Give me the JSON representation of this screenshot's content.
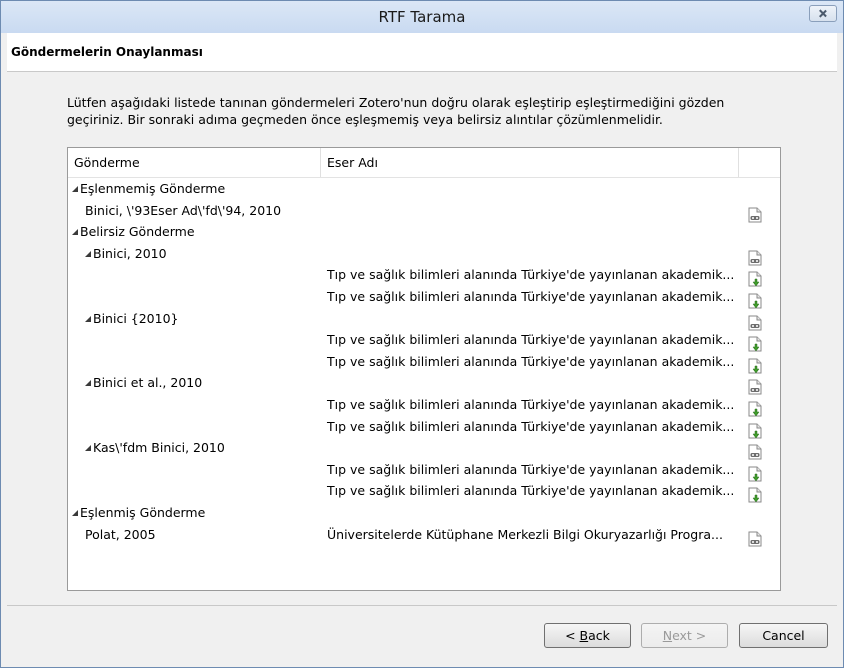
{
  "window": {
    "title": "RTF Tarama"
  },
  "page": {
    "title": "Göndermelerin Onaylanması"
  },
  "description": "Lütfen aşağıdaki listede tanınan göndermeleri Zotero'nun doğru olarak eşleştirip eşleştirmediğini gözden geçiriniz. Bir sonraki adıma geçmeden önce eşleşmemiş veya belirsiz alıntılar çözümlenmelidir.",
  "tree": {
    "columns": [
      "Gönderme",
      "Eser Adı"
    ],
    "rows": [
      {
        "level": 0,
        "expanded": true,
        "citation": "Eşlenmemiş Gönderme",
        "work": "",
        "icon": ""
      },
      {
        "level": 1,
        "expanded": false,
        "citation": "Binici, \\'93Eser Ad\\'fd\\'94, 2010",
        "work": "",
        "icon": "citation-icon"
      },
      {
        "level": 0,
        "expanded": true,
        "citation": "Belirsiz Gönderme",
        "work": "",
        "icon": ""
      },
      {
        "level": 1,
        "expanded": true,
        "citation": "Binici, 2010",
        "work": "",
        "icon": "citation-icon"
      },
      {
        "level": 2,
        "expanded": false,
        "citation": "",
        "work": "Tıp ve sağlık bilimleri alanında Türkiye'de yayınlanan akademik...",
        "icon": "add-item-icon"
      },
      {
        "level": 2,
        "expanded": false,
        "citation": "",
        "work": "Tıp ve sağlık bilimleri alanında Türkiye'de yayınlanan akademik...",
        "icon": "add-item-icon"
      },
      {
        "level": 1,
        "expanded": true,
        "citation": "Binici {2010}",
        "work": "",
        "icon": "citation-icon"
      },
      {
        "level": 2,
        "expanded": false,
        "citation": "",
        "work": "Tıp ve sağlık bilimleri alanında Türkiye'de yayınlanan akademik...",
        "icon": "add-item-icon"
      },
      {
        "level": 2,
        "expanded": false,
        "citation": "",
        "work": "Tıp ve sağlık bilimleri alanında Türkiye'de yayınlanan akademik...",
        "icon": "add-item-icon"
      },
      {
        "level": 1,
        "expanded": true,
        "citation": "Binici et al., 2010",
        "work": "",
        "icon": "citation-icon"
      },
      {
        "level": 2,
        "expanded": false,
        "citation": "",
        "work": "Tıp ve sağlık bilimleri alanında Türkiye'de yayınlanan akademik...",
        "icon": "add-item-icon"
      },
      {
        "level": 2,
        "expanded": false,
        "citation": "",
        "work": "Tıp ve sağlık bilimleri alanında Türkiye'de yayınlanan akademik...",
        "icon": "add-item-icon"
      },
      {
        "level": 1,
        "expanded": true,
        "citation": "Kas\\'fdm Binici, 2010",
        "work": "",
        "icon": "citation-icon"
      },
      {
        "level": 2,
        "expanded": false,
        "citation": "",
        "work": "Tıp ve sağlık bilimleri alanında Türkiye'de yayınlanan akademik...",
        "icon": "add-item-icon"
      },
      {
        "level": 2,
        "expanded": false,
        "citation": "",
        "work": "Tıp ve sağlık bilimleri alanında Türkiye'de yayınlanan akademik...",
        "icon": "add-item-icon"
      },
      {
        "level": 0,
        "expanded": true,
        "citation": "Eşlenmiş Gönderme",
        "work": "",
        "icon": ""
      },
      {
        "level": 1,
        "expanded": false,
        "citation": "Polat, 2005",
        "work": "Üniversitelerde Kütüphane Merkezli Bilgi Okuryazarlığı Progra...",
        "icon": "citation-icon"
      }
    ]
  },
  "buttons": {
    "back_prefix": "< ",
    "back_mnemonic": "B",
    "back_rest": "ack",
    "next_mnemonic": "N",
    "next_rest": "ext >",
    "cancel": "Cancel"
  }
}
